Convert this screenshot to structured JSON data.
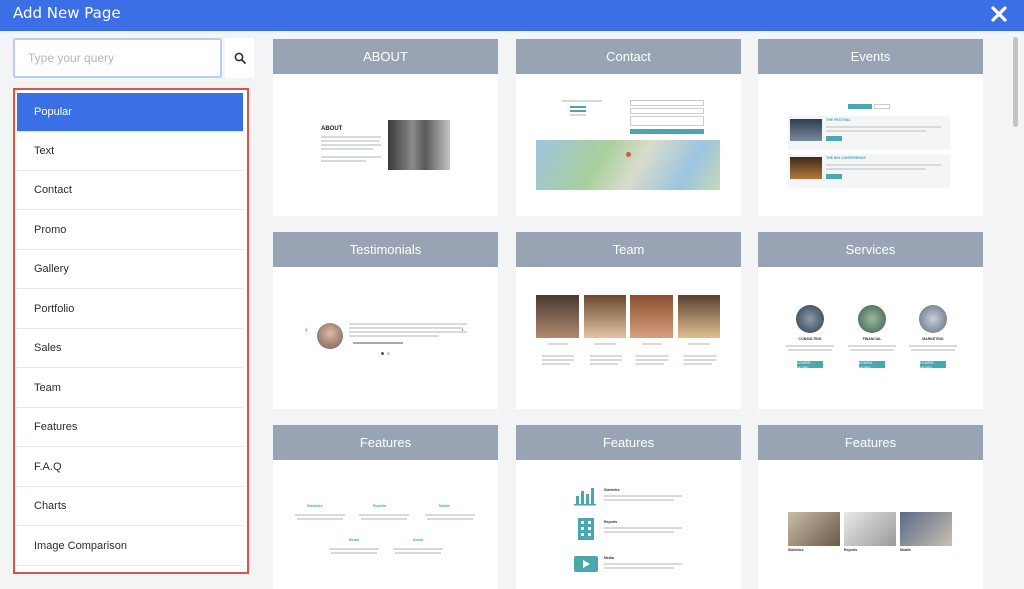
{
  "header": {
    "title": "Add New Page",
    "close_icon": "close-icon"
  },
  "search": {
    "placeholder": "Type your query",
    "icon": "search-icon"
  },
  "categories": [
    {
      "label": "Popular",
      "active": true
    },
    {
      "label": "Text"
    },
    {
      "label": "Contact"
    },
    {
      "label": "Promo"
    },
    {
      "label": "Gallery"
    },
    {
      "label": "Portfolio"
    },
    {
      "label": "Sales"
    },
    {
      "label": "Team"
    },
    {
      "label": "Features"
    },
    {
      "label": "F.A.Q"
    },
    {
      "label": "Charts"
    },
    {
      "label": "Image Comparison"
    }
  ],
  "templates": [
    {
      "title": "ABOUT",
      "preview": {
        "heading": "ABOUT"
      }
    },
    {
      "title": "Contact"
    },
    {
      "title": "Events",
      "preview": {
        "event1": "THE FESTIVAL",
        "event2": "THE BIG CONFERENCE"
      }
    },
    {
      "title": "Testimonials"
    },
    {
      "title": "Team"
    },
    {
      "title": "Services",
      "preview": {
        "s1": "CONSULTING",
        "s2": "FINANCIAL",
        "s3": "MARKETING",
        "btn": "LEARN MORE"
      }
    },
    {
      "title": "Features",
      "preview": {
        "f1": "Statistics",
        "f2": "Reports",
        "f3": "Mobile",
        "f4": "Media",
        "f5": "Social"
      }
    },
    {
      "title": "Features",
      "preview": {
        "f1": "Statistics",
        "f2": "Reports",
        "f3": "Media"
      }
    },
    {
      "title": "Features",
      "preview": {
        "c1": "Statistics",
        "c2": "Reports",
        "c3": "Mobile"
      }
    }
  ],
  "colors": {
    "accent": "#3b6fe6",
    "card_header": "#98a4b3",
    "selection_border": "#d9534f",
    "teal": "#4aa7ae"
  }
}
